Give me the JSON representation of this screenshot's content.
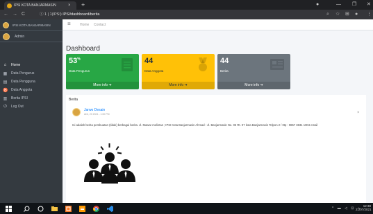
{
  "browser": {
    "tab_title": "IPSI KOTA BANJARMASIN",
    "tab_close": "×",
    "new_tab": "+",
    "nav_back": "←",
    "nav_forward": "→",
    "nav_reload": "C",
    "url_prefix": "ⓘ 1 | 1(IPSI) ",
    "url_rest": "IPSI/dashboard/berita"
  },
  "sidebar": {
    "brand": "IPSI KOTA BANJARMASIN",
    "user": "Admin",
    "items": [
      {
        "label": "Home"
      },
      {
        "label": "Data Pengurus"
      },
      {
        "label": "Data Pengguna"
      },
      {
        "label": "Data Anggota"
      },
      {
        "label": "Berita IPSI"
      },
      {
        "label": "Log Out"
      }
    ]
  },
  "topnav": {
    "home": "Home",
    "contact": "Contact"
  },
  "page_title": "Dashboard",
  "cards": [
    {
      "value": "53",
      "suffix": "%",
      "label": "Data Pengurus",
      "footer": "More info ➔",
      "color": "#28a745"
    },
    {
      "value": "44",
      "suffix": "",
      "label": "Data Anggota",
      "footer": "More info ➔",
      "color": "#ffc107"
    },
    {
      "value": "44",
      "suffix": "",
      "label": "Berita",
      "footer": "More info ➔",
      "color": "#6c757d"
    }
  ],
  "berita": {
    "header": "Berita",
    "author": "Jarwo Desain",
    "date": "Ahli, 20 2021 - 1:00 PM",
    "close": "×",
    "text": "Ini adalah berita pembuatan (tidak) berbagai berita. Jl. Mawar melintas ; IPSI Kota Banjarmasin Ahmad : Jl. Banjarmasin No. 03 Rt. 07 kota Banjarmasin Telpon 2 / 0tp : 0857 3831 1004 email"
  },
  "taskbar": {
    "clock_time": "12:38",
    "clock_date": "21/07/2021"
  },
  "colors": {
    "sidebar": "#343a40",
    "green": "#28a745",
    "yellow": "#ffc107",
    "gray": "#6c757d",
    "link": "#007bff"
  }
}
